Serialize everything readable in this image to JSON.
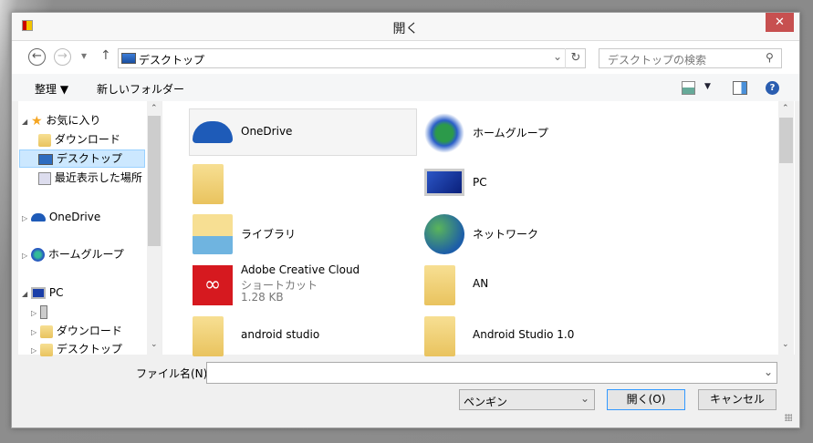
{
  "window": {
    "title": "開く",
    "close": "✕"
  },
  "nav": {
    "back": "←",
    "forward": "→",
    "recent": "▾",
    "up": "↑",
    "address": "デスクトップ",
    "address_dropdown": "⌄",
    "refresh": "↻",
    "search_placeholder": "デスクトップの検索",
    "search_icon": "⚲"
  },
  "toolbar": {
    "organize": "整理 ▼",
    "new_folder": "新しいフォルダー",
    "view_arrow": "▼",
    "help": "?"
  },
  "tree": [
    {
      "label": "お気に入り",
      "expanded": true
    },
    {
      "label": "ダウンロード"
    },
    {
      "label": "デスクトップ",
      "selected": true
    },
    {
      "label": "最近表示した場所"
    },
    {
      "label": "OneDrive"
    },
    {
      "label": "ホームグループ"
    },
    {
      "label": "PC",
      "expanded": true
    },
    {
      "label": ""
    },
    {
      "label": "ダウンロード"
    },
    {
      "label": "デスクトップ"
    }
  ],
  "items": [
    {
      "name": "OneDrive",
      "icon": "onedrive-icon"
    },
    {
      "name": "ホームグループ",
      "icon": "homegroup-icon"
    },
    {
      "name": "",
      "icon": "user-folder-icon"
    },
    {
      "name": "PC",
      "icon": "pc-icon"
    },
    {
      "name": "ライブラリ",
      "icon": "library-icon"
    },
    {
      "name": "ネットワーク",
      "icon": "network-icon"
    },
    {
      "name": "Adobe Creative Cloud",
      "type": "ショートカット",
      "size": "1.28 KB",
      "icon": "adobe-cc-icon"
    },
    {
      "name": "AN",
      "icon": "folder-icon"
    },
    {
      "name": "android studio",
      "icon": "folder-icon"
    },
    {
      "name": "Android Studio 1.0",
      "icon": "folder-icon"
    }
  ],
  "footer": {
    "filename_label": "ファイル名(N):",
    "filename_value": "",
    "filter": "ペンギン",
    "open": "開く(O)",
    "cancel": "キャンセル"
  },
  "colors": {
    "close": "#c75050",
    "selection": "#cce8ff",
    "accent": "#3399ff"
  }
}
